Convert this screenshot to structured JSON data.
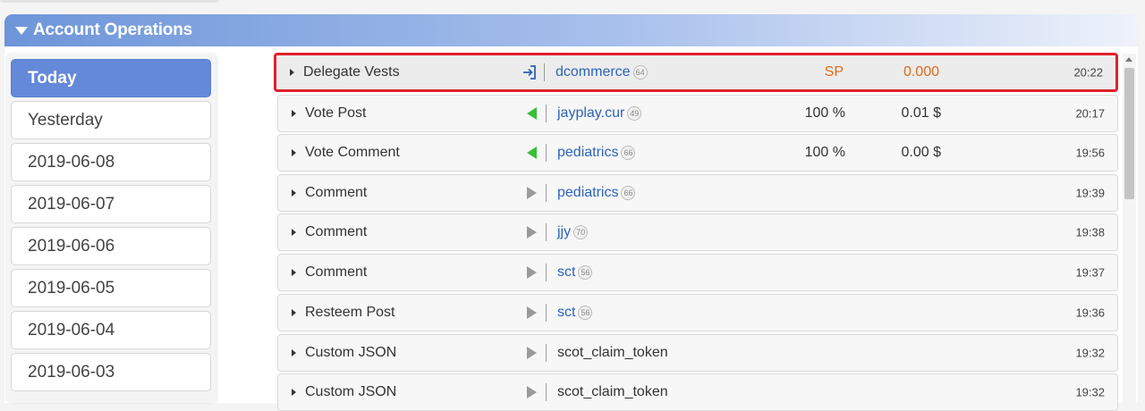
{
  "section": {
    "title": "Account Operations"
  },
  "days": [
    {
      "label": "Today",
      "active": true
    },
    {
      "label": "Yesterday",
      "active": false
    },
    {
      "label": "2019-06-08",
      "active": false
    },
    {
      "label": "2019-06-07",
      "active": false
    },
    {
      "label": "2019-06-06",
      "active": false
    },
    {
      "label": "2019-06-05",
      "active": false
    },
    {
      "label": "2019-06-04",
      "active": false
    },
    {
      "label": "2019-06-03",
      "active": false
    }
  ],
  "operations": [
    {
      "type": "Delegate Vests",
      "icon": "delegate-arrow-icon",
      "account": "dcommerce",
      "reputation": "64",
      "value1": "SP",
      "value2": "0.000",
      "time": "20:22",
      "highlighted": true,
      "accent": "#e06a1a"
    },
    {
      "type": "Vote Post",
      "icon": "incoming-triangle-icon",
      "account": "jayplay.cur",
      "reputation": "49",
      "value1": "100 %",
      "value2": "0.01 $",
      "time": "20:17"
    },
    {
      "type": "Vote Comment",
      "icon": "incoming-triangle-icon",
      "account": "pediatrics",
      "reputation": "66",
      "value1": "100 %",
      "value2": "0.00 $",
      "time": "19:56"
    },
    {
      "type": "Comment",
      "icon": "outgoing-triangle-icon",
      "account": "pediatrics",
      "reputation": "66",
      "value1": "",
      "value2": "",
      "time": "19:39"
    },
    {
      "type": "Comment",
      "icon": "outgoing-triangle-icon",
      "account": "jjy",
      "reputation": "70",
      "value1": "",
      "value2": "",
      "time": "19:38"
    },
    {
      "type": "Comment",
      "icon": "outgoing-triangle-icon",
      "account": "sct",
      "reputation": "56",
      "value1": "",
      "value2": "",
      "time": "19:37"
    },
    {
      "type": "Resteem Post",
      "icon": "outgoing-triangle-icon",
      "account": "sct",
      "reputation": "56",
      "value1": "",
      "value2": "",
      "time": "19:36"
    },
    {
      "type": "Custom JSON",
      "icon": "outgoing-triangle-icon",
      "account": "scot_claim_token",
      "reputation": "",
      "value1": "",
      "value2": "",
      "time": "19:32"
    },
    {
      "type": "Custom JSON",
      "icon": "outgoing-triangle-icon",
      "account": "scot_claim_token",
      "reputation": "",
      "value1": "",
      "value2": "",
      "time": "19:32"
    }
  ],
  "colors": {
    "active_day": "#6489d9",
    "link": "#2c63b8",
    "highlight_border": "#e0202a",
    "vote_icon": "#38c038"
  }
}
